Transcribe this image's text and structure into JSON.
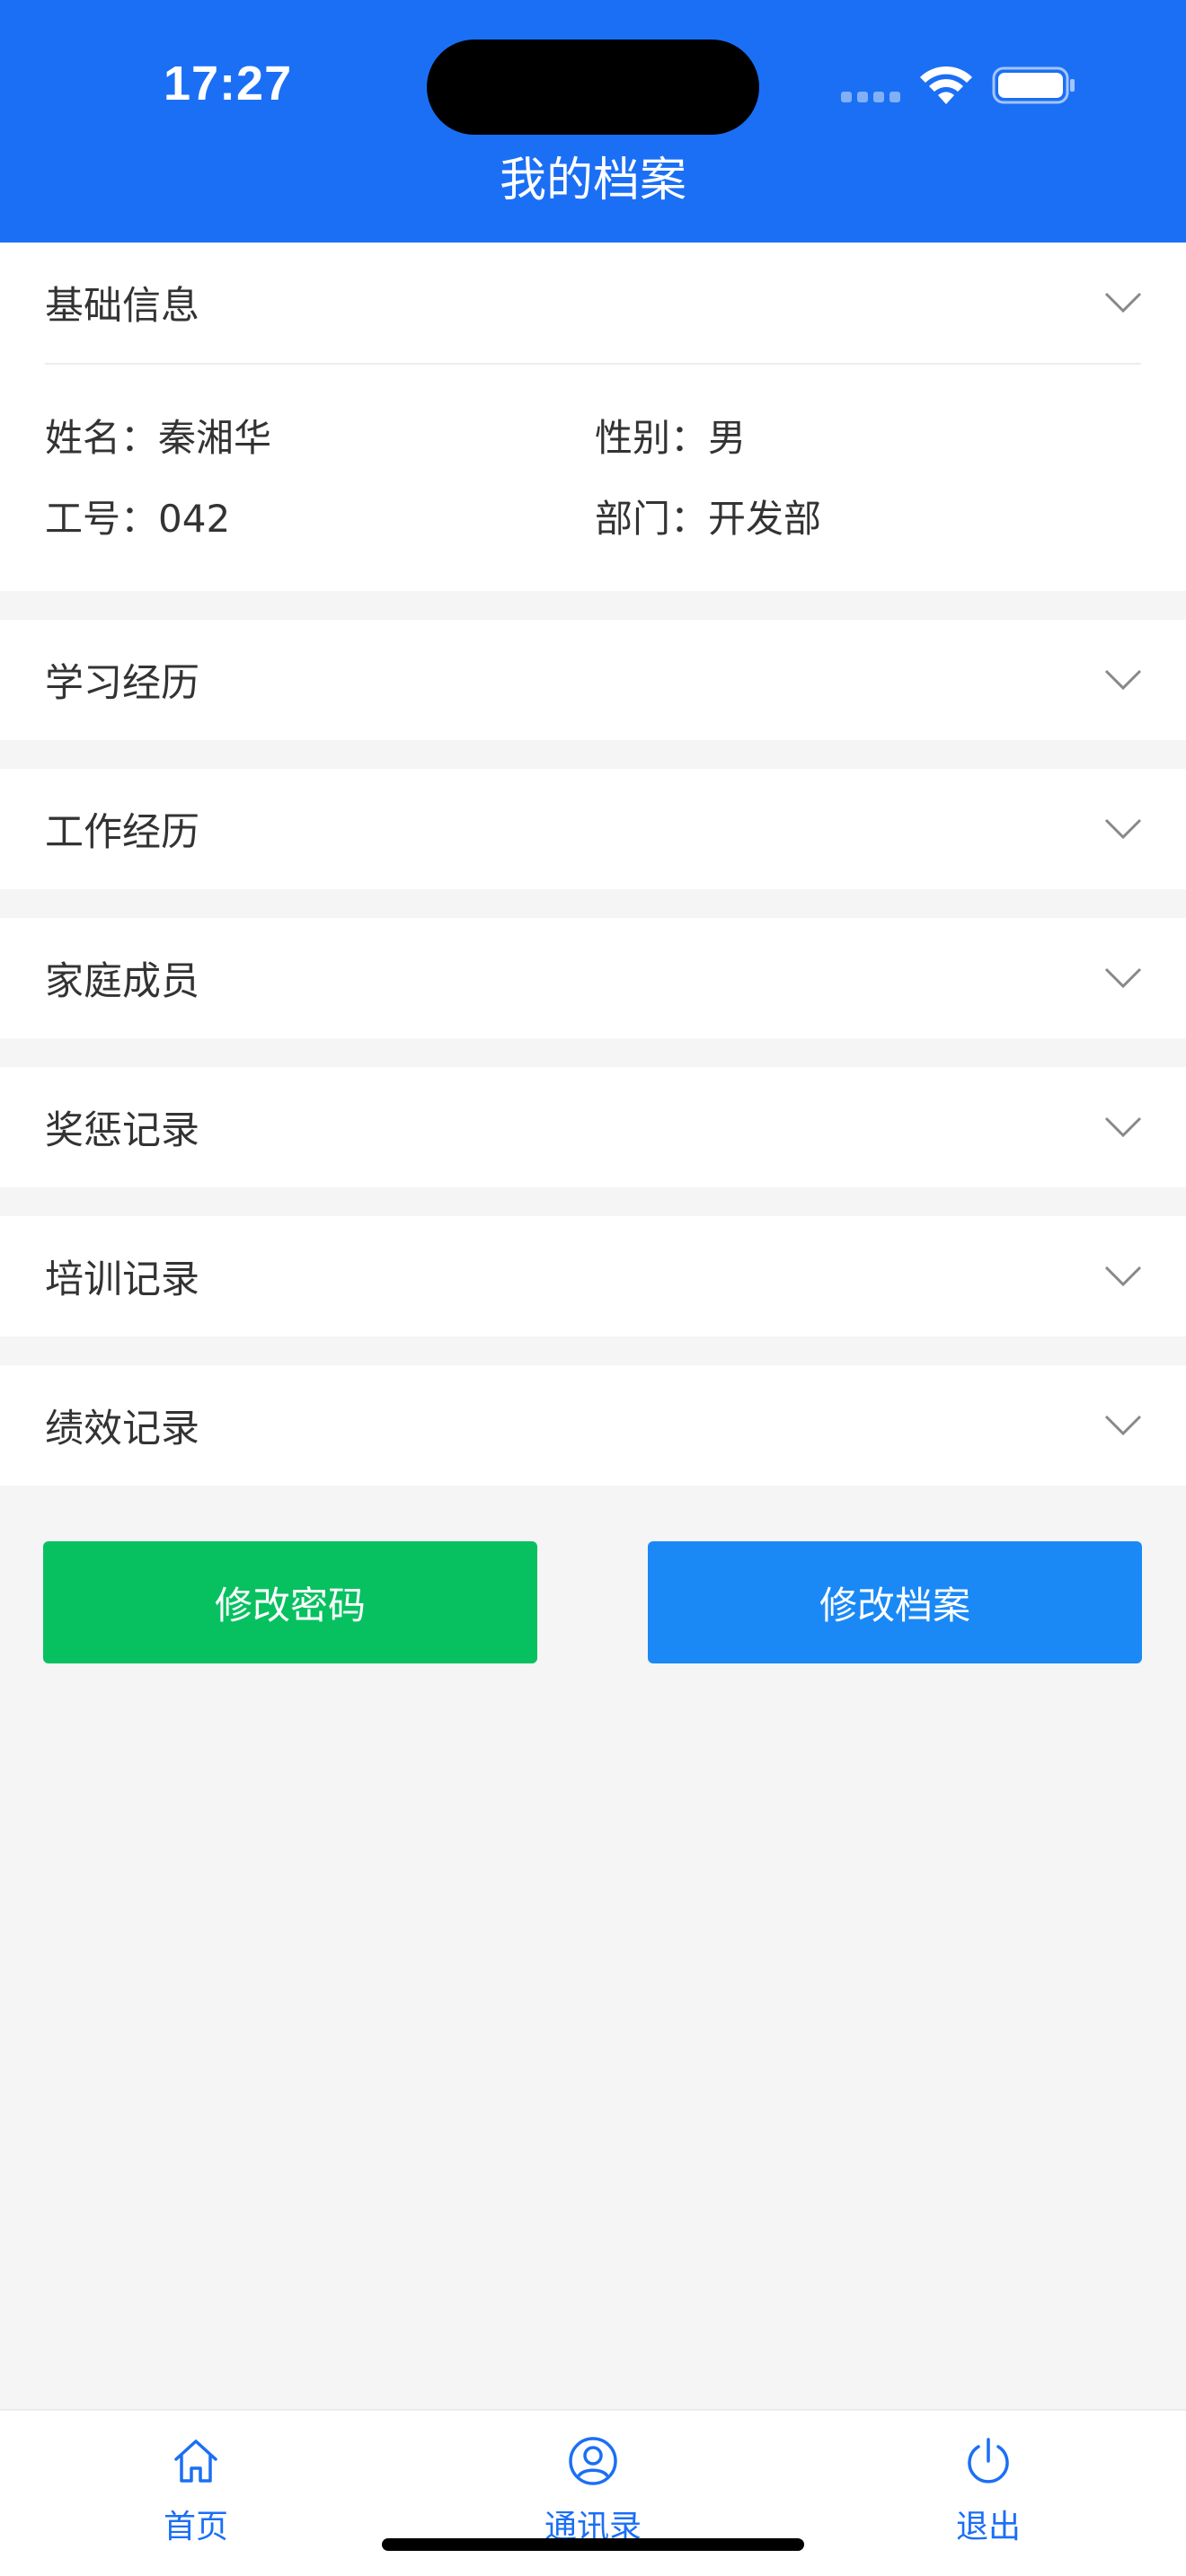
{
  "status_bar": {
    "time": "17:27"
  },
  "header": {
    "title": "我的档案"
  },
  "basic_info": {
    "title": "基础信息",
    "fields": [
      {
        "label": "姓名：",
        "value": "秦湘华"
      },
      {
        "label": "性别：",
        "value": "男"
      },
      {
        "label": "工号：",
        "value": "042"
      },
      {
        "label": "部门：",
        "value": "开发部"
      }
    ]
  },
  "sections": [
    {
      "title": "学习经历"
    },
    {
      "title": "工作经历"
    },
    {
      "title": "家庭成员"
    },
    {
      "title": "奖惩记录"
    },
    {
      "title": "培训记录"
    },
    {
      "title": "绩效记录"
    }
  ],
  "buttons": {
    "change_password": "修改密码",
    "edit_profile": "修改档案"
  },
  "tabbar": {
    "items": [
      {
        "label": "首页",
        "icon": "home-icon"
      },
      {
        "label": "通讯录",
        "icon": "user-circle-icon"
      },
      {
        "label": "退出",
        "icon": "power-icon"
      }
    ]
  },
  "colors": {
    "primary": "#1b6ff5",
    "green": "#07c160",
    "blue_button": "#1a89f5",
    "background": "#f5f5f5"
  }
}
